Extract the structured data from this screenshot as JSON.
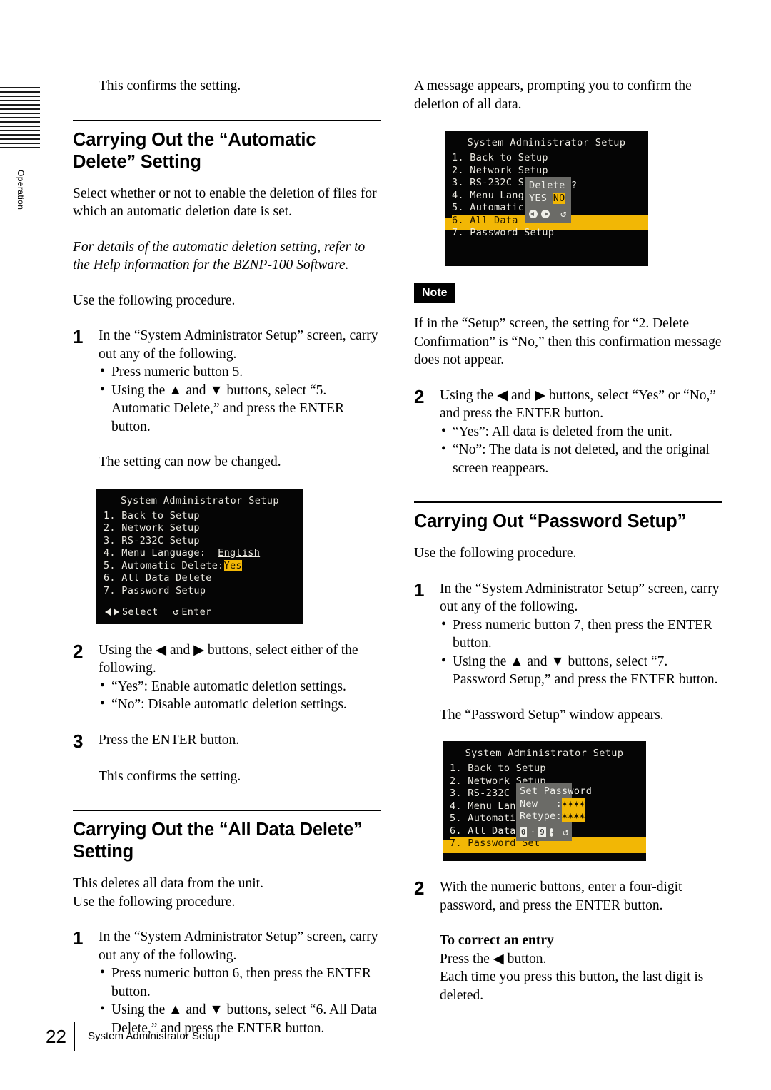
{
  "edge": {
    "tab_label": "Operation",
    "mark_count": 15
  },
  "footer": {
    "page_number": "22",
    "chapter": "System Administrator Setup"
  },
  "left_column": {
    "intro_confirm": "This confirms the setting.",
    "heading_auto_delete": "Carrying Out the “Automatic Delete” Setting",
    "auto_delete_desc": "Select whether or not to enable the deletion of files for which an automatic deletion date is set.",
    "auto_delete_italic": "For details of the automatic deletion setting, refer to the Help information for the BZNP-100 Software.",
    "use_procedure": "Use the following procedure.",
    "step1_num": "1",
    "step1_text": "In the “System Administrator Setup” screen, carry out any of the following.",
    "step1_bullets": [
      "Press numeric button 5.",
      "Using the ▲ and ▼ buttons, select “5. Automatic Delete,” and press the ENTER button."
    ],
    "step1_result": "The setting can now be changed.",
    "step2_num": "2",
    "step2_text": "Using the ◀ and ▶ buttons, select either of the following.",
    "step2_bullets": [
      "“Yes”: Enable automatic deletion settings.",
      "“No”: Disable automatic deletion settings."
    ],
    "step3_num": "3",
    "step3_text": "Press the ENTER button.",
    "step3_result": "This confirms the setting.",
    "heading_all_data_delete": "Carrying Out the “All Data Delete” Setting",
    "all_delete_desc_line1": "This deletes all data from the unit.",
    "all_delete_desc_line2": "Use the following procedure.",
    "adstep1_num": "1",
    "adstep1_text": "In the “System Administrator Setup” screen, carry out any of the following.",
    "adstep1_bullets": [
      "Press numeric button 6, then press the ENTER button.",
      "Using the ▲ and ▼ buttons, select “6. All Data Delete,” and press the ENTER button."
    ]
  },
  "right_column": {
    "message_appears": "A message appears, prompting you to confirm the deletion of all data.",
    "note_label": "Note",
    "note_text": "If in the “Setup” screen, the setting for “2. Delete Confirmation” is “No,” then this confirmation message does not appear.",
    "step2_num": "2",
    "step2_text": "Using the ◀ and ▶ buttons, select “Yes” or “No,” and press the ENTER button.",
    "step2_bullets": [
      "“Yes”: All data is deleted from the unit.",
      "“No”: The data is not deleted, and the original screen reappears."
    ],
    "heading_password_setup": "Carrying Out “Password Setup”",
    "use_procedure": "Use the following procedure.",
    "pwstep1_num": "1",
    "pwstep1_text": "In the “System Administrator Setup” screen, carry out any of the following.",
    "pwstep1_bullets": [
      "Press numeric button 7, then press the ENTER button.",
      "Using the ▲ and ▼ buttons, select “7. Password Setup,” and press the ENTER button."
    ],
    "pwstep1_result": "The “Password Setup” window appears.",
    "pwstep2_num": "2",
    "pwstep2_text": "With the numeric buttons, enter a four-digit password, and press the ENTER button.",
    "correct_entry_heading": "To correct an entry",
    "correct_entry_line1": "Press the ◀ button.",
    "correct_entry_line2": "Each time you press this button, the last digit is deleted."
  },
  "lcd_screens": {
    "screen1": {
      "title": "System Administrator Setup",
      "items": [
        "1. Back to Setup",
        "2. Network Setup",
        "3. RS-232C Setup",
        "4. Menu Language:",
        "5. Automatic Delete:",
        "6. All Data Delete",
        "7. Password Setup"
      ],
      "value_language": "English",
      "value_auto_delete": "Yes",
      "footer_select": "Select",
      "footer_enter": "Enter"
    },
    "screen2": {
      "title": "System Administrator Setup",
      "items": [
        "1. Back to Setup",
        "2. Network Setup",
        "3. RS-232C Setup",
        "4. Menu Language:",
        "5. Automatic Dele",
        "6. All Data Delet",
        "7. Password Setup"
      ],
      "highlighted_index": 5,
      "dialog": {
        "prompt": "Delete ?",
        "option_yes": "YES",
        "option_no": "NO",
        "selected": "NO"
      }
    },
    "screen3": {
      "title": "System Administrator Setup",
      "items": [
        "1. Back to Setup",
        "2. Network Setup",
        "3. RS-232C Setu",
        "4. Menu Languag",
        "5. Automatic De",
        "6. All Data Del",
        "7. Password Set"
      ],
      "highlighted_index": 6,
      "dialog": {
        "title": "Set Password",
        "label_new": "New   :",
        "value_new": "✶✶✶✶",
        "label_retype": "Retype:",
        "value_retype": "✶✶✶✶",
        "key_range_from": "0",
        "key_range_dash": "-",
        "key_range_to": "9"
      }
    }
  },
  "colors": {
    "lcd_background": "#050505",
    "lcd_text": "#eceae2",
    "highlight_yellow": "#f2b705",
    "dialog_gray": "#6b6b67"
  }
}
